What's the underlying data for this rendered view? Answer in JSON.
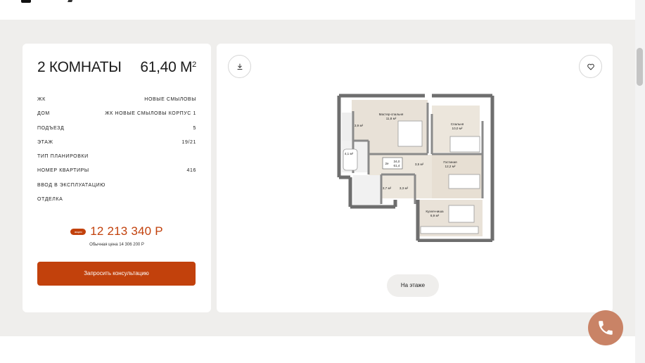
{
  "header": {
    "logo_icon": "logo-mark"
  },
  "summary": {
    "rooms": "2 КОМНАТЫ",
    "area": "61,40 М",
    "area_unit_sup": "2",
    "specs": [
      {
        "label": "ЖК",
        "value": "НОВЫЕ СМЫЛОВЫ"
      },
      {
        "label": "ДОМ",
        "value": "ЖК НОВЫЕ СМЫЛОВЫ КОРПУС 1"
      },
      {
        "label": "ПОДЪЕЗД",
        "value": "5"
      },
      {
        "label": "ЭТАЖ",
        "value": "19/21"
      },
      {
        "label": "ТИП ПЛАНИРОВКИ",
        "value": ""
      },
      {
        "label": "НОМЕР КВАРТИРЫ",
        "value": "416"
      },
      {
        "label": "ВВОД В ЭКСПЛУАТАЦИЮ",
        "value": ""
      },
      {
        "label": "ОТДЕЛКА",
        "value": ""
      }
    ],
    "promo_badge": "акция",
    "price": "12 213 340 Р",
    "old_price": "Обычная цена 14 306 200 Р",
    "consult_button": "Запросить консультацию"
  },
  "plan": {
    "download_icon": "download-icon",
    "favorite_icon": "heart-icon",
    "rooms": [
      {
        "name": "Мастер-спальня",
        "area": "11,8 м²"
      },
      {
        "name": "Спальня",
        "area": "10,0 м²"
      },
      {
        "name": "",
        "area": "3,9 м²"
      },
      {
        "name": "",
        "area": "4,1 м²"
      },
      {
        "name": "",
        "area": "3,5 м²"
      },
      {
        "name": "Гостиная",
        "area": "12,2 м²"
      },
      {
        "name": "",
        "area": "3,7 м²"
      },
      {
        "name": "",
        "area": "3,3 м²"
      },
      {
        "name": "Кухня-ниша",
        "area": "6,9 м²"
      }
    ],
    "plan_tag": {
      "rooms": "2е",
      "area": "34,0",
      "total": "61,4"
    },
    "floor_button": "На этаже"
  },
  "call": {
    "icon": "phone-icon"
  },
  "colors": {
    "accent": "#c2410c",
    "call": "#c98366",
    "background": "#efeeec"
  }
}
